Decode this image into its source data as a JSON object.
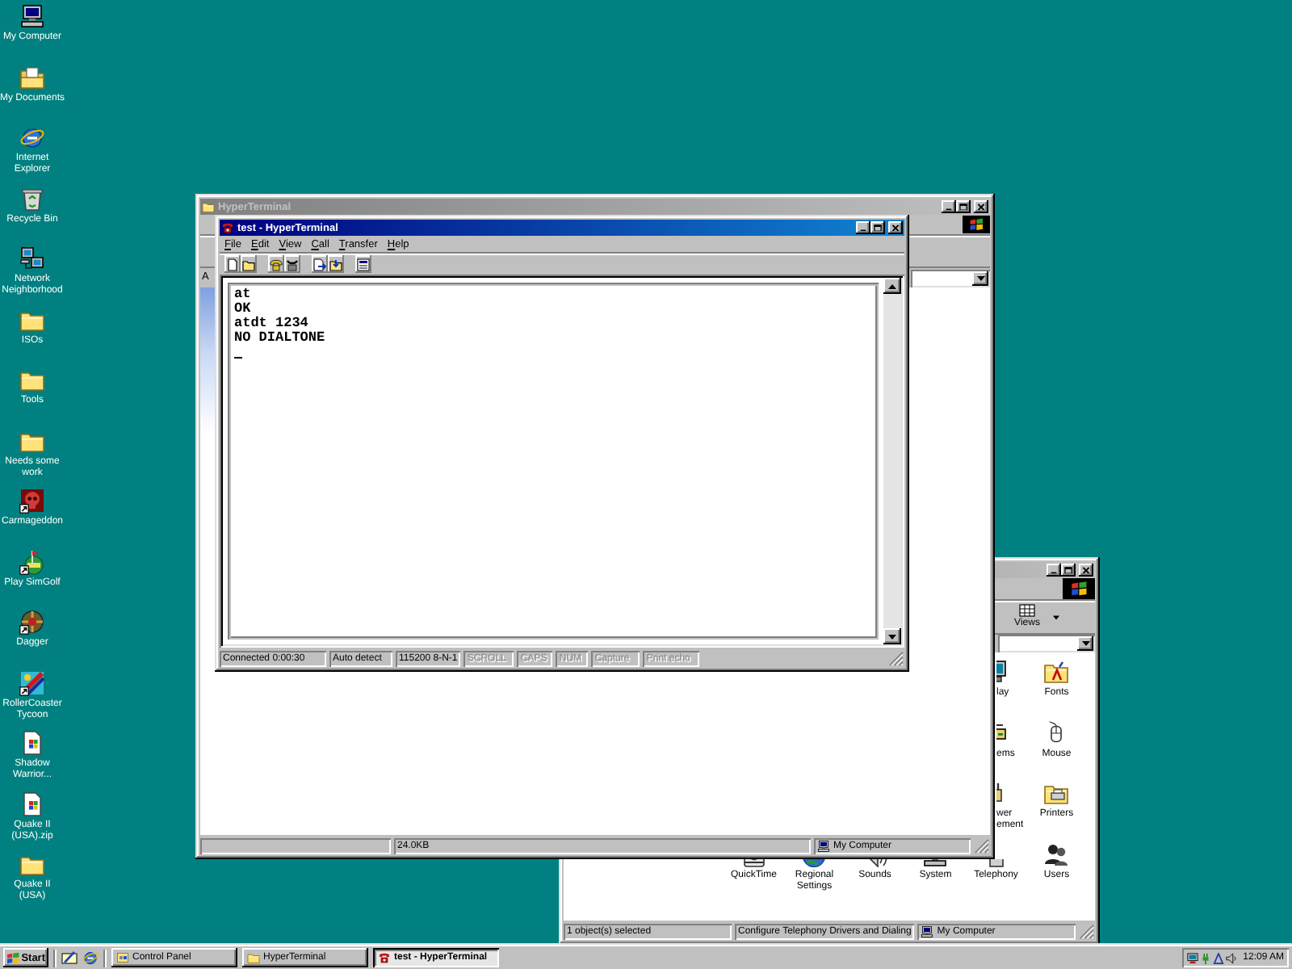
{
  "desktop_icons": [
    {
      "label": "My Computer",
      "kind": "computer",
      "shortcut": false
    },
    {
      "label": "My Documents",
      "kind": "documents",
      "shortcut": false
    },
    {
      "label": "Internet Explorer",
      "kind": "browser",
      "shortcut": false
    },
    {
      "label": "Recycle Bin",
      "kind": "recycle-bin",
      "shortcut": false
    },
    {
      "label": "Network Neighborhood",
      "kind": "network",
      "shortcut": false
    },
    {
      "label": "ISOs",
      "kind": "folder",
      "shortcut": false
    },
    {
      "label": "Tools",
      "kind": "folder",
      "shortcut": false
    },
    {
      "label": "Needs some work",
      "kind": "folder",
      "shortcut": false
    },
    {
      "label": "Carmageddon",
      "kind": "skull",
      "shortcut": true
    },
    {
      "label": "Play SimGolf",
      "kind": "golf",
      "shortcut": true
    },
    {
      "label": "Dagger",
      "kind": "shield",
      "shortcut": true
    },
    {
      "label": "RollerCoaster Tycoon",
      "kind": "coaster",
      "shortcut": true
    },
    {
      "label": "Shadow Warrior...",
      "kind": "file",
      "shortcut": false
    },
    {
      "label": "Quake II (USA).zip",
      "kind": "file",
      "shortcut": false
    },
    {
      "label": "Quake II (USA)",
      "kind": "folder",
      "shortcut": false
    }
  ],
  "folder_window": {
    "title": "HyperTerminal",
    "active": false,
    "address_label": "A",
    "status": {
      "size": "24.0KB",
      "location": "My Computer"
    }
  },
  "terminal_window": {
    "title": "test - HyperTerminal",
    "active": true,
    "menu": [
      "File",
      "Edit",
      "View",
      "Call",
      "Transfer",
      "Help"
    ],
    "lines": [
      "at",
      "OK",
      "atdt 1234",
      "NO DIALTONE"
    ],
    "status": [
      {
        "text": "Connected 0:00:30",
        "disabled": false
      },
      {
        "text": "Auto detect",
        "disabled": false
      },
      {
        "text": "115200 8-N-1",
        "disabled": false
      },
      {
        "text": "SCROLL",
        "disabled": true
      },
      {
        "text": "CAPS",
        "disabled": true
      },
      {
        "text": "NUM",
        "disabled": true
      },
      {
        "text": "Capture",
        "disabled": true
      },
      {
        "text": "Print echo",
        "disabled": true
      }
    ]
  },
  "control_panel_window": {
    "active": false,
    "views_label": "Views",
    "rows": [
      [
        {
          "label": "lay",
          "kind": "monitor"
        },
        {
          "label": "Fonts",
          "kind": "font-folder"
        }
      ],
      [
        {
          "label": "ems",
          "kind": "modem"
        },
        {
          "label": "Mouse",
          "kind": "mouse"
        }
      ],
      [
        {
          "label": "wer ement",
          "kind": "plug"
        },
        {
          "label": "Printers",
          "kind": "printer-folder"
        }
      ],
      [
        {
          "label": "QuickTime",
          "kind": "film"
        },
        {
          "label": "Regional Settings",
          "kind": "globe"
        },
        {
          "label": "Sounds",
          "kind": "speaker"
        },
        {
          "label": "System",
          "kind": "computer"
        },
        {
          "label": "Telephony",
          "kind": "telephone"
        },
        {
          "label": "Users",
          "kind": "users"
        }
      ]
    ],
    "status": {
      "selection": "1 object(s) selected",
      "hint": "Configure Telephony Drivers and Dialing",
      "location": "My Computer"
    }
  },
  "taskbar": {
    "start_label": "Start",
    "tasks": [
      {
        "label": "Control Panel",
        "kind": "control-panel",
        "selected": false
      },
      {
        "label": "HyperTerminal",
        "kind": "folder",
        "selected": false
      },
      {
        "label": "test - HyperTerminal",
        "kind": "terminal",
        "selected": true
      }
    ],
    "clock": "12:09 AM"
  }
}
